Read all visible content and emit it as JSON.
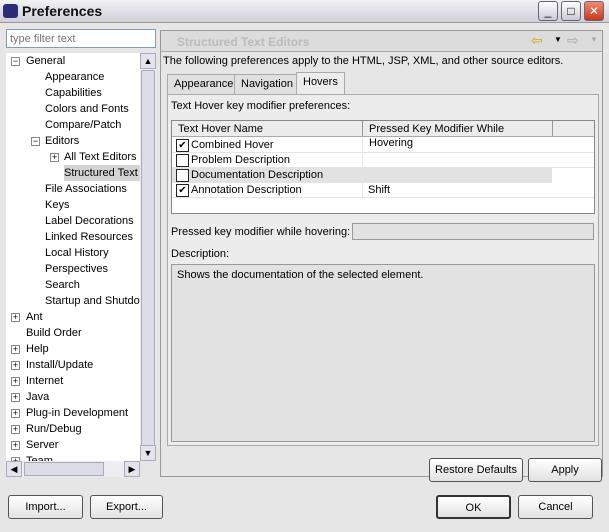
{
  "window": {
    "title": "Preferences",
    "minimize": "_",
    "maximize": "□",
    "close": "✕"
  },
  "filter": {
    "placeholder": "type filter text"
  },
  "tree": [
    {
      "label": "General",
      "expander": "−",
      "level": 0
    },
    {
      "label": "Appearance",
      "level": 2
    },
    {
      "label": "Capabilities",
      "level": 2
    },
    {
      "label": "Colors and Fonts",
      "level": 2
    },
    {
      "label": "Compare/Patch",
      "level": 2
    },
    {
      "label": "Editors",
      "expander": "−",
      "level": 1
    },
    {
      "label": "All Text Editors",
      "expander": "+",
      "level": 2
    },
    {
      "label": "Structured Text Editors",
      "level": 3,
      "selected": true
    },
    {
      "label": "File Associations",
      "level": 2
    },
    {
      "label": "Keys",
      "level": 2
    },
    {
      "label": "Label Decorations",
      "level": 2
    },
    {
      "label": "Linked Resources",
      "level": 2
    },
    {
      "label": "Local History",
      "level": 2
    },
    {
      "label": "Perspectives",
      "level": 2
    },
    {
      "label": "Search",
      "level": 2
    },
    {
      "label": "Startup and Shutdown",
      "level": 2
    },
    {
      "label": "Ant",
      "expander": "+",
      "level": 0
    },
    {
      "label": "Build Order",
      "level": 0
    },
    {
      "label": "Help",
      "expander": "+",
      "level": 0
    },
    {
      "label": "Install/Update",
      "expander": "+",
      "level": 0
    },
    {
      "label": "Internet",
      "expander": "+",
      "level": 0
    },
    {
      "label": "Java",
      "expander": "+",
      "level": 0
    },
    {
      "label": "Plug-in Development",
      "expander": "+",
      "level": 0
    },
    {
      "label": "Run/Debug",
      "expander": "+",
      "level": 0
    },
    {
      "label": "Server",
      "expander": "+",
      "level": 0
    },
    {
      "label": "Team",
      "expander": "+",
      "level": 0
    }
  ],
  "panel": {
    "title": "Structured Text Editors",
    "intro": "The following preferences apply to the HTML, JSP, XML, and other source editors.",
    "tabs": [
      "Appearance",
      "Navigation",
      "Hovers"
    ],
    "active_tab": "Hovers",
    "table_label": "Text Hover key modifier preferences:",
    "columns": [
      "Text Hover Name",
      "Pressed Key Modifier While Hovering"
    ],
    "rows": [
      {
        "name": "Combined Hover",
        "checked": true,
        "modifier": ""
      },
      {
        "name": "Problem Description",
        "checked": false,
        "modifier": ""
      },
      {
        "name": "Documentation Description",
        "checked": false,
        "modifier": "",
        "selected": true
      },
      {
        "name": "Annotation Description",
        "checked": true,
        "modifier": "Shift"
      }
    ],
    "modifier_label": "Pressed key modifier while hovering:",
    "modifier_value": "",
    "description_label": "Description:",
    "description": "Shows the documentation of the selected element.",
    "restore_defaults": "Restore Defaults",
    "apply": "Apply"
  },
  "footer": {
    "import": "Import...",
    "export": "Export...",
    "ok": "OK",
    "cancel": "Cancel"
  }
}
